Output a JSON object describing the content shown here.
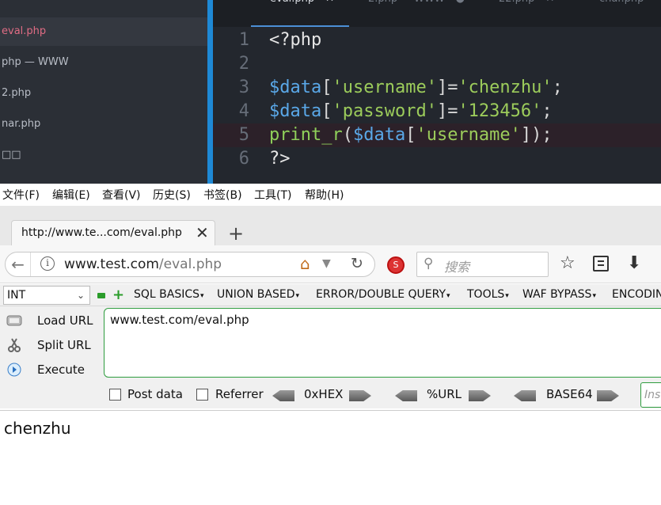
{
  "editor": {
    "sidebar_items": [
      {
        "label": "eval.php",
        "active": true
      },
      {
        "label": "php — WWW",
        "active": false
      },
      {
        "label": "2.php",
        "active": false
      },
      {
        "label": "nar.php",
        "active": false
      },
      {
        "label": "□□",
        "active": false
      },
      {
        "label": "· ·· ······ ·",
        "active": false
      }
    ],
    "tabs": [
      {
        "label": "eval.php",
        "close": "✕",
        "current": true
      },
      {
        "label": "2.php",
        "close": "",
        "current": false
      },
      {
        "label": "WWW",
        "close": "●",
        "current": false
      },
      {
        "label": "22.php",
        "close": "✕",
        "current": false
      },
      {
        "label": "char.php",
        "close": "",
        "current": false
      }
    ],
    "lines": [
      {
        "num": "1",
        "code": "<?php"
      },
      {
        "num": "2",
        "code": ""
      },
      {
        "num": "3",
        "code": "$data['username']='chenzhu';"
      },
      {
        "num": "4",
        "code": "$data['password']='123456';"
      },
      {
        "num": "5",
        "code": "print_r($data['username']);"
      },
      {
        "num": "6",
        "code": "?>"
      }
    ],
    "highlight_line": 5
  },
  "menubar": [
    "文件(F)",
    "编辑(E)",
    "查看(V)",
    "历史(S)",
    "书签(B)",
    "工具(T)",
    "帮助(H)"
  ],
  "browser_tab": {
    "title": "http://www.te...com/eval.php",
    "close": "✕",
    "new_tab": "+"
  },
  "navbar": {
    "url_host": "www.test.com",
    "url_path": "/eval.php",
    "search_placeholder": "搜索"
  },
  "hackbar": {
    "select_value": "INT",
    "menus": [
      "SQL BASICS",
      "UNION BASED",
      "ERROR/DOUBLE QUERY",
      "TOOLS",
      "WAF BYPASS",
      "ENCODING"
    ],
    "buttons": [
      "Load URL",
      "Split URL",
      "Execute"
    ],
    "url_value": "www.test.com/eval.php",
    "post_label": "Post data",
    "referrer_label": "Referrer",
    "encoders": [
      "0xHEX",
      "%URL",
      "BASE64"
    ],
    "insert_placeholder": "Insert"
  },
  "page_output": "chenzhu",
  "colors": {
    "accent_blue": "#1e89d6",
    "active_file": "#e06c84",
    "hackbar_border": "#2e9c3e"
  }
}
